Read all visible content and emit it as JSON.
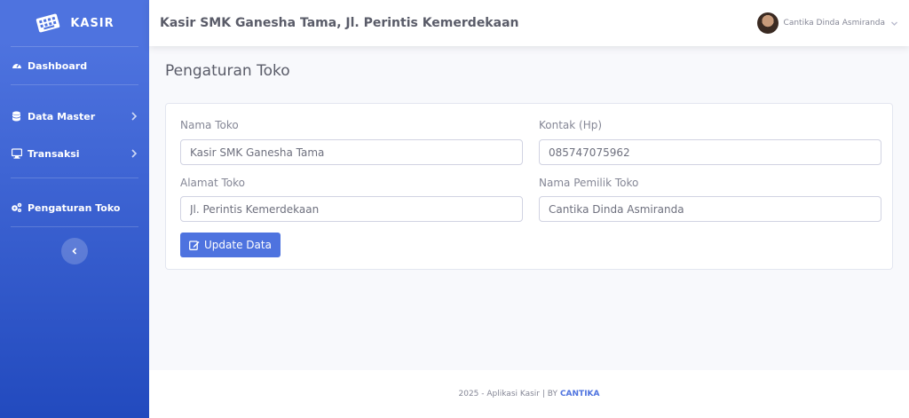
{
  "brand": {
    "name": "KASIR",
    "logo_icon": "keyboard-icon"
  },
  "sidebar": {
    "items": [
      {
        "label": "Dashboard",
        "icon": "tachometer-icon"
      },
      {
        "label": "Data Master",
        "icon": "database-icon"
      },
      {
        "label": "Transaksi",
        "icon": "desktop-icon"
      },
      {
        "label": "Pengaturan Toko",
        "icon": "cogs-icon"
      }
    ],
    "toggle_icon": "chevron-left-icon"
  },
  "topbar": {
    "title": "Kasir SMK Ganesha Tama, Jl. Perintis Kemerdekaan",
    "user_name": "Cantika Dinda Asmiranda"
  },
  "page": {
    "title": "Pengaturan Toko"
  },
  "form": {
    "nama_toko": {
      "label": "Nama Toko",
      "value": "Kasir SMK Ganesha Tama"
    },
    "kontak": {
      "label": "Kontak (Hp)",
      "value": "085747075962"
    },
    "alamat": {
      "label": "Alamat Toko",
      "value": "Jl. Perintis Kemerdekaan"
    },
    "pemilik": {
      "label": "Nama Pemilik Toko",
      "value": "Cantika Dinda Asmiranda"
    },
    "submit_label": "Update Data"
  },
  "footer": {
    "text": "2025 - Aplikasi Kasir | BY",
    "author": "CANTIKA"
  },
  "colors": {
    "primary": "#4e73df",
    "primary_dark": "#224abe",
    "bg": "#f8f9fc",
    "text": "#858796"
  }
}
